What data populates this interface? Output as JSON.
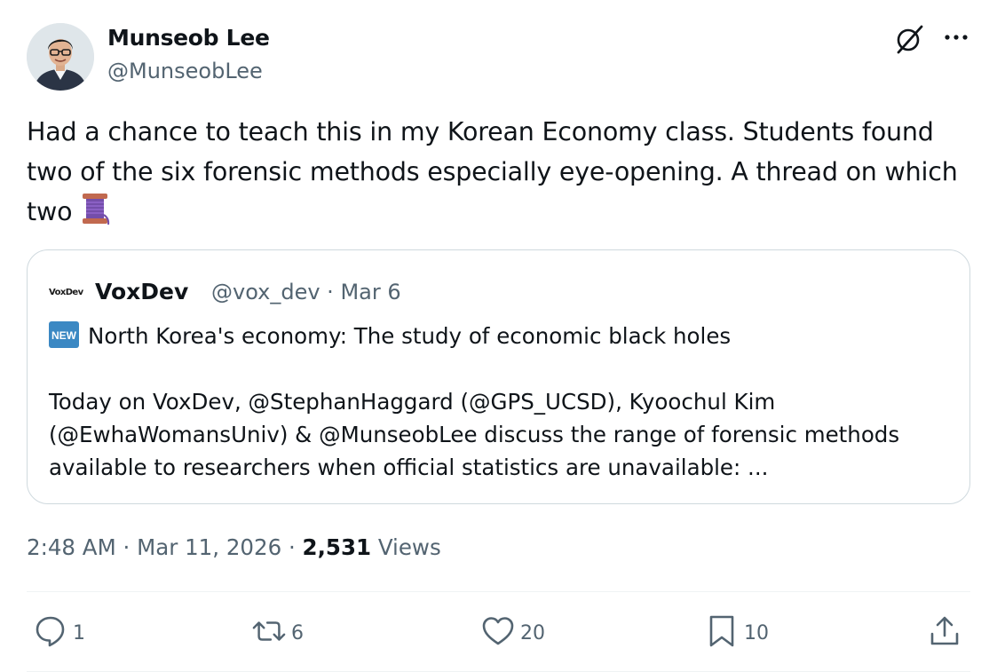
{
  "author": {
    "name": "Munseob Lee",
    "handle": "@MunseobLee"
  },
  "tweet": {
    "lines": [
      "Had a chance to teach this in my Korean Economy class. Students found",
      "two of the six forensic methods especially eye-opening. A thread on which",
      "two"
    ],
    "emoji": "thread-spool-emoji"
  },
  "quote": {
    "logo_text": "VoxDev",
    "name": "VoxDev",
    "meta": "@vox_dev · Mar 6",
    "headline": "North Korea's economy: The study of economic black holes",
    "body_lines": [
      "Today on VoxDev, @StephanHaggard (@GPS_UCSD), Kyoochul Kim",
      "(@EwhaWomansUniv) & @MunseobLee discuss the range of forensic methods",
      "available to researchers when official statistics are unavailable: ..."
    ],
    "badge": "NEW"
  },
  "meta": {
    "time": "2:48 AM · Mar 11, 2026 · ",
    "views_count": "2,531",
    "views_label": " Views"
  },
  "actions": {
    "replies": "1",
    "reposts": "6",
    "likes": "20",
    "bookmarks": "10"
  },
  "colors": {
    "text": "#0f1419",
    "secondary": "#536471",
    "border": "#cfd9de",
    "new_badge": "#3b88c3"
  }
}
